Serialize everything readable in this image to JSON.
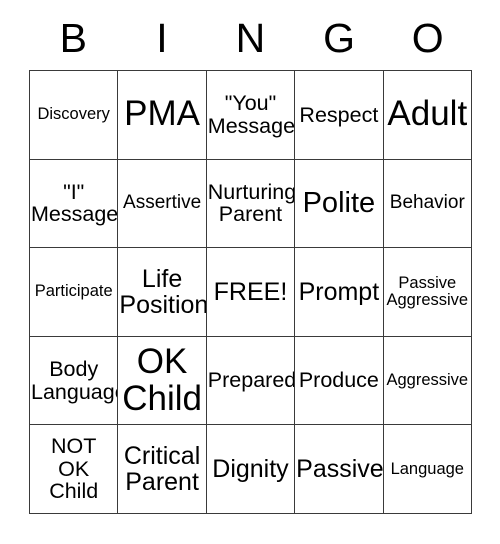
{
  "card": {
    "header_letters": [
      "B",
      "I",
      "N",
      "G",
      "O"
    ],
    "free_space_label": "FREE!",
    "grid": [
      [
        {
          "text": "Discovery",
          "size": "sz-s"
        },
        {
          "text": "PMA",
          "size": "sz-xxl"
        },
        {
          "text": "\"You\"\nMessage",
          "size": "sz-ml"
        },
        {
          "text": "Respect",
          "size": "sz-ml"
        },
        {
          "text": "Adult",
          "size": "sz-xxl"
        }
      ],
      [
        {
          "text": "\"I\"\nMessage",
          "size": "sz-ml"
        },
        {
          "text": "Assertive",
          "size": "sz-m"
        },
        {
          "text": "Nurturing\nParent",
          "size": "sz-ml"
        },
        {
          "text": "Polite",
          "size": "sz-xl"
        },
        {
          "text": "Behavior",
          "size": "sz-m"
        }
      ],
      [
        {
          "text": "Participate",
          "size": "sz-s"
        },
        {
          "text": "Life\nPosition",
          "size": "sz-l"
        },
        {
          "text": "FREE!",
          "size": "sz-l"
        },
        {
          "text": "Prompt",
          "size": "sz-l"
        },
        {
          "text": "Passive\nAggressive",
          "size": "sz-s"
        }
      ],
      [
        {
          "text": "Body\nLanguage",
          "size": "sz-ml"
        },
        {
          "text": "OK\nChild",
          "size": "sz-xxl"
        },
        {
          "text": "Prepared",
          "size": "sz-ml"
        },
        {
          "text": "Produce",
          "size": "sz-ml"
        },
        {
          "text": "Aggressive",
          "size": "sz-s"
        }
      ],
      [
        {
          "text": "NOT\nOK\nChild",
          "size": "sz-ml"
        },
        {
          "text": "Critical\nParent",
          "size": "sz-l"
        },
        {
          "text": "Dignity",
          "size": "sz-l"
        },
        {
          "text": "Passive",
          "size": "sz-l"
        },
        {
          "text": "Language",
          "size": "sz-s"
        }
      ]
    ]
  },
  "colors": {
    "border": "#3a3a3a",
    "text": "#000000",
    "background": "#ffffff"
  }
}
